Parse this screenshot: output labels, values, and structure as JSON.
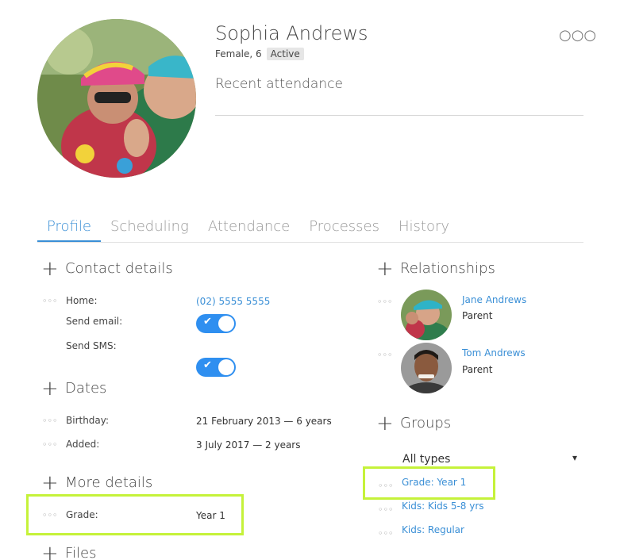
{
  "person": {
    "name": "Sophia Andrews",
    "meta": "Female, 6",
    "status": "Active",
    "recent_label": "Recent attendance"
  },
  "tabs": [
    "Profile",
    "Scheduling",
    "Attendance",
    "Processes",
    "History"
  ],
  "contact": {
    "title": "Contact details",
    "home_label": "Home:",
    "home_value": "(02) 5555 5555",
    "email_label": "Send email:",
    "sms_label": "Send SMS:"
  },
  "dates": {
    "title": "Dates",
    "birthday_label": "Birthday:",
    "birthday_value": "21 February 2013 — 6 years",
    "added_label": "Added:",
    "added_value": "3 July 2017 — 2 years"
  },
  "more": {
    "title": "More details",
    "grade_label": "Grade:",
    "grade_value": "Year 1"
  },
  "files": {
    "title": "Files"
  },
  "relationships": {
    "title": "Relationships",
    "items": [
      {
        "name": "Jane Andrews",
        "role": "Parent"
      },
      {
        "name": "Tom Andrews",
        "role": "Parent"
      }
    ]
  },
  "groups": {
    "title": "Groups",
    "filter": "All types",
    "items": [
      "Grade: Year 1",
      "Kids: Kids 5-8 yrs",
      "Kids: Regular"
    ]
  },
  "icons": {
    "dots": "◦◦◦",
    "more_top": "○○○",
    "plus": "+",
    "check": "✔",
    "caret": "▾"
  },
  "colors": {
    "accent": "#3a8fd6",
    "toggle": "#2f8ff0",
    "highlight": "#c5f23a"
  }
}
